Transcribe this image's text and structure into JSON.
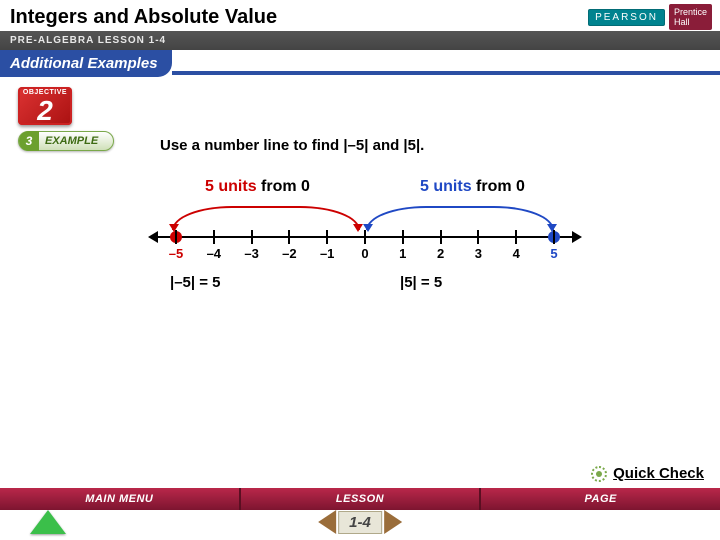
{
  "header": {
    "title": "Integers and Absolute Value",
    "subtitle": "PRE-ALGEBRA LESSON 1-4",
    "examples_label": "Additional Examples"
  },
  "brand": {
    "publisher": "PEARSON",
    "imprint_line1": "Prentice",
    "imprint_line2": "Hall"
  },
  "objective": {
    "label": "OBJECTIVE",
    "number": "2"
  },
  "example": {
    "number": "3",
    "label": "EXAMPLE"
  },
  "prompt": "Use a number line to find |–5| and |5|.",
  "diagram": {
    "left_label_colored": "5 units",
    "left_label_plain": "from 0",
    "right_label_colored": "5 units",
    "right_label_plain": "from 0",
    "ticks": [
      "–5",
      "–4",
      "–3",
      "–2",
      "–1",
      "0",
      "1",
      "2",
      "3",
      "4",
      "5"
    ]
  },
  "answers": {
    "a1": "|–5| = 5",
    "a2": "|5| = 5"
  },
  "quickcheck": "Quick Check",
  "footer": {
    "buttons": [
      "MAIN MENU",
      "LESSON",
      "PAGE"
    ],
    "page": "1-4"
  }
}
